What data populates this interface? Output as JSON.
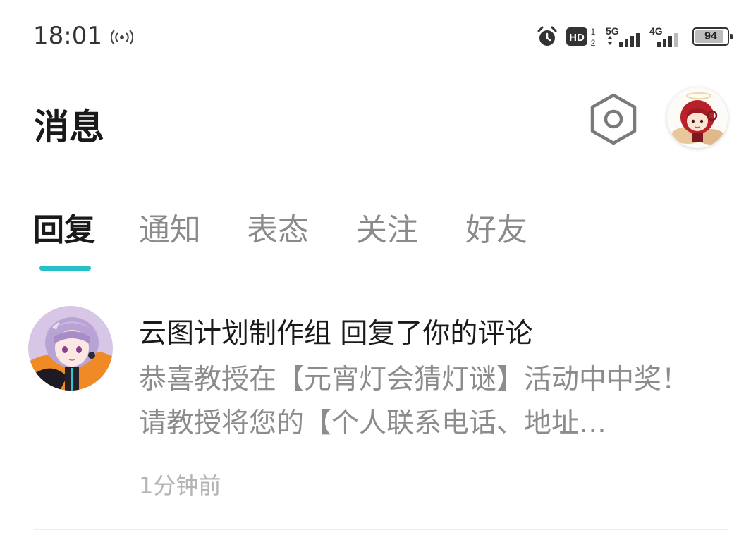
{
  "status_bar": {
    "time": "18:01",
    "battery": "94",
    "battery_level": 0.94,
    "net_1": "5G",
    "net_2": "4G",
    "hd_label": "HD",
    "sim_top": "1",
    "sim_bottom": "2"
  },
  "header": {
    "title": "消息"
  },
  "tabs": [
    {
      "label": "回复",
      "active": true
    },
    {
      "label": "通知",
      "active": false
    },
    {
      "label": "表态",
      "active": false
    },
    {
      "label": "关注",
      "active": false
    },
    {
      "label": "好友",
      "active": false
    }
  ],
  "accent_color": "#26c1c7",
  "messages": [
    {
      "title": "云图计划制作组 回复了你的评论",
      "body": "恭喜教授在【元宵灯会猜灯谜】活动中中奖！请教授将您的【个人联系电话、地址…",
      "time": "1分钟前"
    }
  ]
}
